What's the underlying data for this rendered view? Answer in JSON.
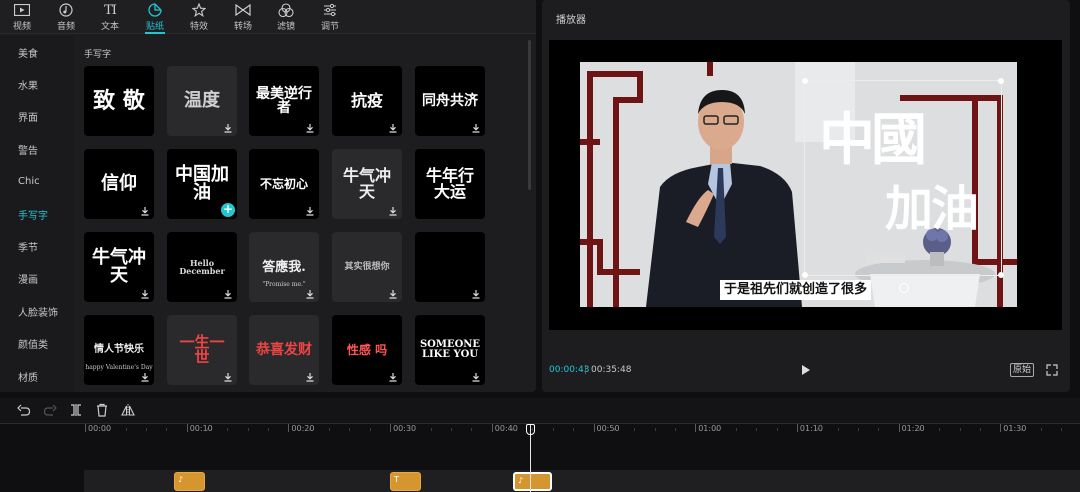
{
  "tabs": [
    {
      "label": "视频",
      "icon": "video-icon"
    },
    {
      "label": "音频",
      "icon": "audio-icon"
    },
    {
      "label": "文本",
      "icon": "text-icon"
    },
    {
      "label": "贴纸",
      "icon": "sticker-icon",
      "active": true
    },
    {
      "label": "特效",
      "icon": "effects-icon"
    },
    {
      "label": "转场",
      "icon": "transition-icon"
    },
    {
      "label": "滤镜",
      "icon": "filter-icon"
    },
    {
      "label": "调节",
      "icon": "adjust-icon"
    }
  ],
  "categories": [
    {
      "label": "美食"
    },
    {
      "label": "水果"
    },
    {
      "label": "界面"
    },
    {
      "label": "警告"
    },
    {
      "label": "Chic"
    },
    {
      "label": "手写字",
      "active": true
    },
    {
      "label": "季节"
    },
    {
      "label": "漫画"
    },
    {
      "label": "人脸装饰"
    },
    {
      "label": "颜值类"
    },
    {
      "label": "材质"
    }
  ],
  "section_title": "手写字",
  "stickers": [
    {
      "text": "致 敬",
      "style": "black",
      "download": false
    },
    {
      "text": "温度",
      "style": "gray",
      "download": true
    },
    {
      "text": "最美逆行者",
      "style": "black",
      "download": true
    },
    {
      "text": "抗疫",
      "style": "black",
      "download": true
    },
    {
      "text": "同舟共济",
      "style": "black",
      "download": true
    },
    {
      "text": "信仰",
      "style": "black",
      "download": true
    },
    {
      "text": "中国加油",
      "style": "black",
      "download": false,
      "add": true
    },
    {
      "text": "不忘初心",
      "style": "black",
      "download": true
    },
    {
      "text": "牛气冲天",
      "style": "gray",
      "download": true
    },
    {
      "text": "牛年行大运",
      "style": "black",
      "download": false
    },
    {
      "text": "牛气冲天",
      "style": "black",
      "download": true
    },
    {
      "text": "Hello December",
      "style": "black",
      "download": true
    },
    {
      "text": "答應我.",
      "subtext": "\"Promise me.\"",
      "style": "gray",
      "download": true
    },
    {
      "text": "其实很想你",
      "style": "gray",
      "download": true
    },
    {
      "text": "",
      "style": "black",
      "download": true
    },
    {
      "text": "情人节快乐",
      "subtext": "happy Valentine's Day",
      "style": "black",
      "download": true
    },
    {
      "text": "一生一世",
      "style": "gray",
      "download": true
    },
    {
      "text": "恭喜发财",
      "style": "gray",
      "download": true
    },
    {
      "text": "性感 吗",
      "style": "black",
      "download": true
    },
    {
      "text": "SOMEONE LIKE YOU",
      "style": "black",
      "download": true
    }
  ],
  "player": {
    "title": "播放器",
    "current_time": "00:00:43",
    "separator": "|",
    "total_time": "00:35:48",
    "original_label": "原始",
    "sticker_text_1": "中國",
    "sticker_text_2": "加油",
    "subtitle": "于是祖先们就创造了很多"
  },
  "timeline": {
    "ticks": [
      "00:00",
      "00:10",
      "00:20",
      "00:30",
      "00:40",
      "00:50",
      "01:00",
      "01:10",
      "01:20",
      "01:30"
    ],
    "clips": [
      {
        "label": "♪"
      },
      {
        "label": "T"
      },
      {
        "label": "♪"
      }
    ]
  },
  "colors": {
    "accent": "#1fc7d4",
    "clip": "#d6962f"
  }
}
